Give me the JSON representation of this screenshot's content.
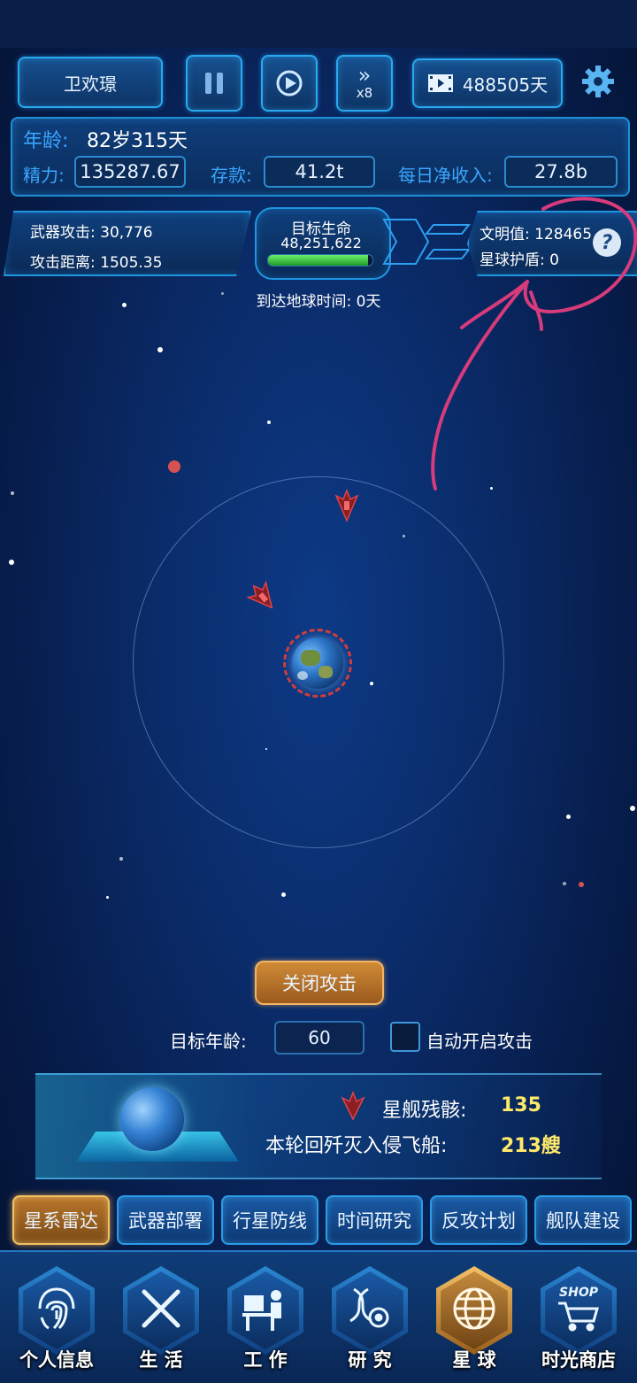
{
  "header": {
    "player_name": "卫欢璟",
    "speed_label": "x8",
    "video_days": "488505天"
  },
  "stats": {
    "age_label": "年龄:",
    "age_value": "82岁315天",
    "energy_label": "精力:",
    "energy_value": "135287.67",
    "savings_label": "存款:",
    "savings_value": "41.2t",
    "income_label": "每日净收入:",
    "income_value": "27.8b"
  },
  "hud": {
    "weapon_attack": "武器攻击: 30,776",
    "attack_range": "攻击距离: 1505.35",
    "target_life_label": "目标生命",
    "target_life_value": "48,251,622",
    "target_life_fraction": 0.96,
    "civilization": "文明值: 128465",
    "planet_shield": "星球护盾: 0",
    "eta": "到达地球时间: 0天"
  },
  "controls": {
    "close_attack": "关闭攻击",
    "target_age_label": "目标年龄:",
    "target_age_value": "60",
    "auto_attack_label": "自动开启攻击"
  },
  "summary": {
    "wreck_label": "星舰残骸:",
    "wreck_value": "135",
    "destroyed_label": "本轮回歼灭入侵飞船:",
    "destroyed_value": "213艘"
  },
  "tabs": [
    {
      "label": "星系雷达",
      "active": true
    },
    {
      "label": "武器部署",
      "active": false
    },
    {
      "label": "行星防线",
      "active": false
    },
    {
      "label": "时间研究",
      "active": false
    },
    {
      "label": "反攻计划",
      "active": false
    },
    {
      "label": "舰队建设",
      "active": false
    }
  ],
  "nav": [
    {
      "label": "个人信息",
      "icon": "fingerprint-icon",
      "active": false
    },
    {
      "label": "生 活",
      "icon": "fork-knife-icon",
      "active": false
    },
    {
      "label": "工 作",
      "icon": "desk-worker-icon",
      "active": false
    },
    {
      "label": "研 究",
      "icon": "dna-gear-icon",
      "active": false
    },
    {
      "label": "星 球",
      "icon": "globe-icon",
      "active": true
    },
    {
      "label": "时光商店",
      "icon": "shop-cart-icon",
      "active": false
    },
    {
      "shop_badge": "SHOP"
    }
  ],
  "colors": {
    "accent_blue": "#3aa6ff",
    "gold": "#f4c162",
    "annotation": "#d63b7c",
    "hp_green": "#2fc23a"
  }
}
